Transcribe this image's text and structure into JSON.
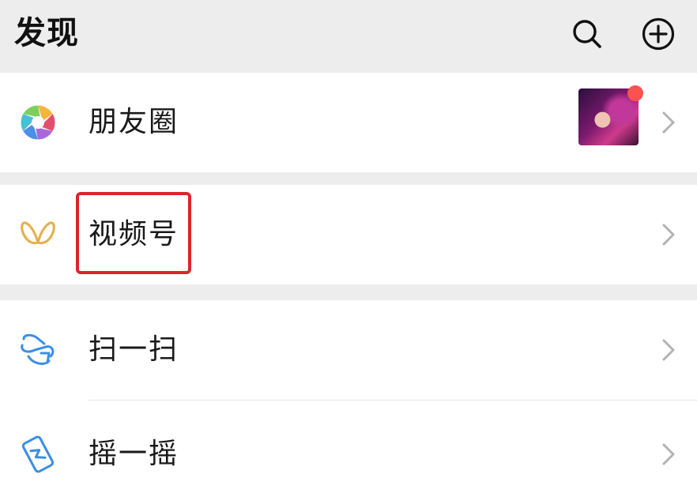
{
  "header": {
    "title": "发现",
    "search_icon": "search-icon",
    "add_icon": "add-circle-icon"
  },
  "menu": {
    "moments": {
      "label": "朋友圈",
      "icon": "moments-aperture-icon",
      "has_new_indicator": true,
      "indicator_color": "#fa5151"
    },
    "channels": {
      "label": "视频号",
      "icon": "channels-butterfly-icon",
      "highlighted": true,
      "highlight_color": "#d9262c"
    },
    "scan": {
      "label": "扫一扫",
      "icon": "scan-icon"
    },
    "shake": {
      "label": "摇一摇",
      "icon": "shake-icon"
    }
  },
  "colors": {
    "background": "#ededed",
    "card": "#ffffff",
    "icon_blue": "#3a8ee6",
    "channels_gold": "#e3b24f",
    "chevron": "#b2b2b2"
  }
}
